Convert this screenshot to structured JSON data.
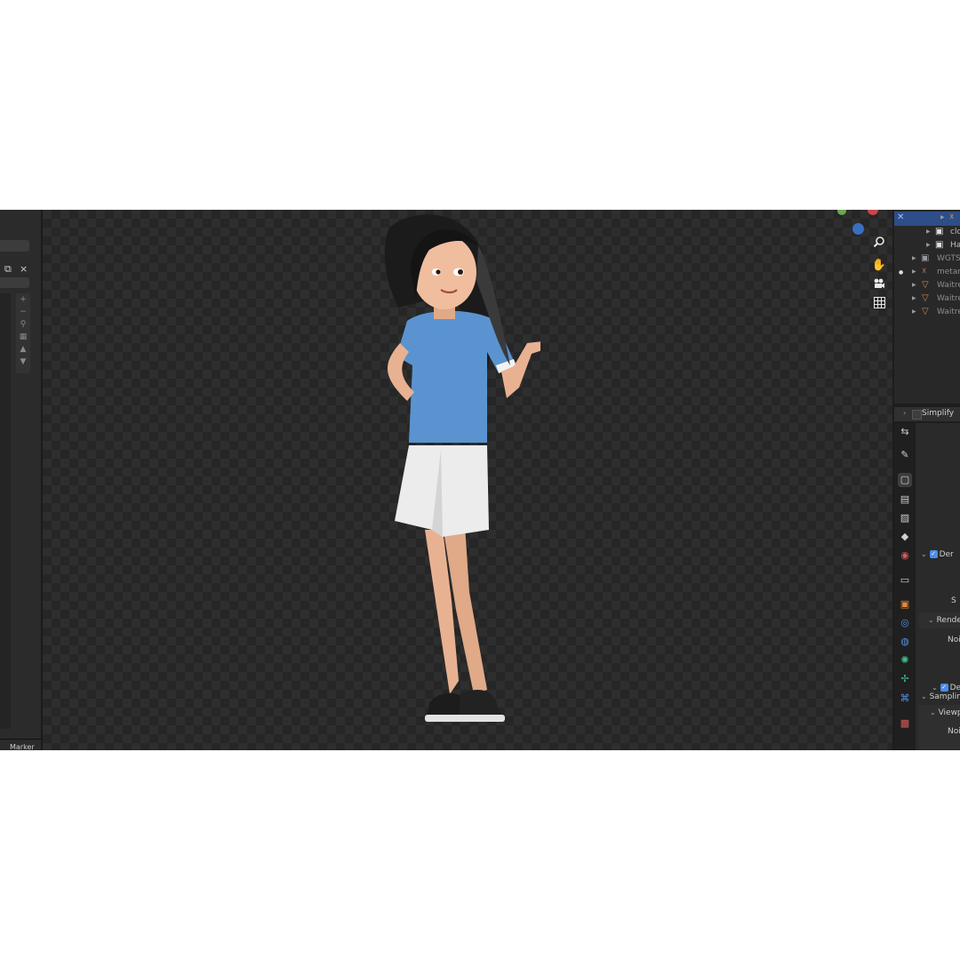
{
  "left_panel": {
    "marker_label": "Marker",
    "close_icon": "×",
    "copy_icon": "⧉",
    "tools": [
      "+",
      "−",
      "⚲",
      "▦",
      "▲",
      "▼"
    ]
  },
  "outliner": {
    "rows": [
      {
        "label": "",
        "icon": "armature-icon",
        "selected": true
      },
      {
        "label": "clo",
        "icon": "collection-icon"
      },
      {
        "label": "Ha",
        "icon": "collection-icon"
      },
      {
        "label": "WGTS_",
        "icon": "collection-icon"
      },
      {
        "label": "metarig",
        "icon": "armature-icon"
      },
      {
        "label": "Waitre",
        "icon": "mesh-icon"
      },
      {
        "label": "Waitre",
        "icon": "mesh-icon"
      },
      {
        "label": "Waitre",
        "icon": "mesh-icon"
      }
    ]
  },
  "properties": {
    "header_label": "Simplify",
    "sampling": "Sampling",
    "viewport": "Viewp",
    "noise1": "Nois",
    "denoise1": "Der",
    "s_label": "S",
    "render": "Rende",
    "noise2": "Nois",
    "denoise2": "Der"
  },
  "colors": {
    "accent": "#2d4e86",
    "checkbox": "#4a8ee8",
    "shirt": "#5b93d0",
    "skirt": "#ececec"
  }
}
